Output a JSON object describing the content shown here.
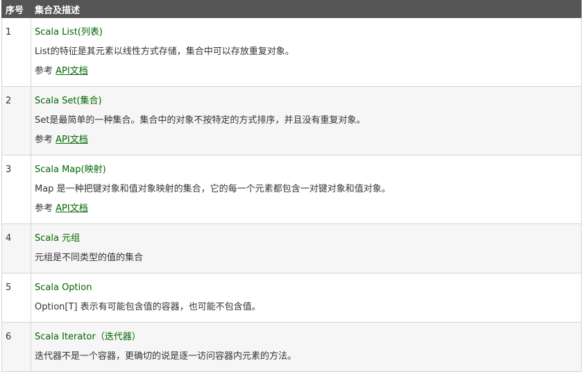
{
  "header": {
    "col_index": "序号",
    "col_desc": "集合及描述"
  },
  "rows": [
    {
      "index": "1",
      "title": "Scala List(列表)",
      "desc": "List的特征是其元素以线性方式存储，集合中可以存放重复对象。",
      "ref_prefix": "参考 ",
      "ref_link": "API文档"
    },
    {
      "index": "2",
      "title": "Scala Set(集合)",
      "desc": "Set是最简单的一种集合。集合中的对象不按特定的方式排序，并且没有重复对象。",
      "ref_prefix": "参考 ",
      "ref_link": "API文档"
    },
    {
      "index": "3",
      "title": "Scala Map(映射)",
      "desc": "Map 是一种把键对象和值对象映射的集合，它的每一个元素都包含一对键对象和值对象。",
      "ref_prefix": "参考 ",
      "ref_link": "API文档"
    },
    {
      "index": "4",
      "title": "Scala 元组",
      "desc": "元组是不同类型的值的集合"
    },
    {
      "index": "5",
      "title": "Scala Option",
      "desc": "Option[T] 表示有可能包含值的容器，也可能不包含值。"
    },
    {
      "index": "6",
      "title": "Scala Iterator（迭代器）",
      "desc": "迭代器不是一个容器，更确切的说是逐一访问容器内元素的方法。"
    }
  ]
}
